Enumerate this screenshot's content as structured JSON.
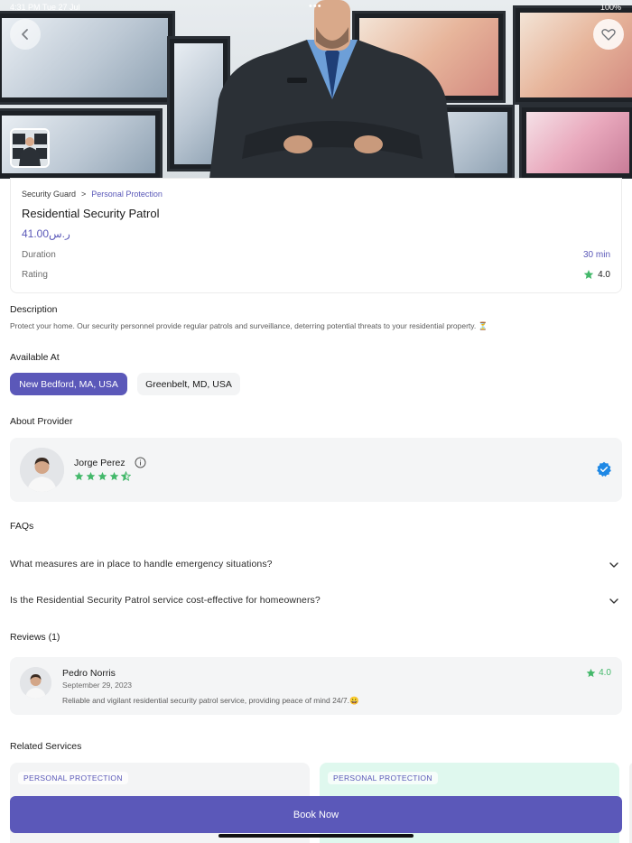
{
  "status": {
    "time": "4:31 PM  Tue 27 Jul",
    "dots": "•••",
    "battery": "100%"
  },
  "header": {
    "back_icon": "chevron-left-icon",
    "favorite_icon": "heart-outline-icon"
  },
  "service": {
    "breadcrumb_parent": "Security Guard",
    "breadcrumb_sep": ">",
    "breadcrumb_child": "Personal Protection",
    "title": "Residential Security Patrol",
    "price": "41.00ر.س",
    "duration_label": "Duration",
    "duration_value": "30 min",
    "rating_label": "Rating",
    "rating_value": "4.0"
  },
  "description": {
    "heading": "Description",
    "text": "Protect your home. Our security personnel provide regular patrols and surveillance, deterring potential threats to your residential property. ⏳"
  },
  "available": {
    "heading": "Available At",
    "locations": [
      "New Bedford, MA, USA",
      "Greenbelt, MD, USA"
    ],
    "selected": 0
  },
  "provider": {
    "heading": "About Provider",
    "name": "Jorge Perez",
    "rating": 4.5,
    "info_icon": "info-icon",
    "verified_icon": "verified-badge-icon"
  },
  "faqs": {
    "heading": "FAQs",
    "items": [
      "What measures are in place to handle emergency situations?",
      "Is the Residential Security Patrol service cost-effective for homeowners?"
    ]
  },
  "reviews": {
    "heading": "Reviews (1)",
    "items": [
      {
        "name": "Pedro Norris",
        "date": "September 29, 2023",
        "text": "Reliable and vigilant residential security patrol service, providing peace of mind 24/7.😀",
        "rating": "4.0"
      }
    ]
  },
  "related": {
    "heading": "Related Services",
    "cards": [
      {
        "tag": "PERSONAL PROTECTION"
      },
      {
        "tag": "PERSONAL PROTECTION"
      }
    ]
  },
  "cta": {
    "book_label": "Book Now"
  },
  "colors": {
    "accent": "#5b58b9",
    "star": "#43b86a",
    "verified": "#1e88e5"
  }
}
